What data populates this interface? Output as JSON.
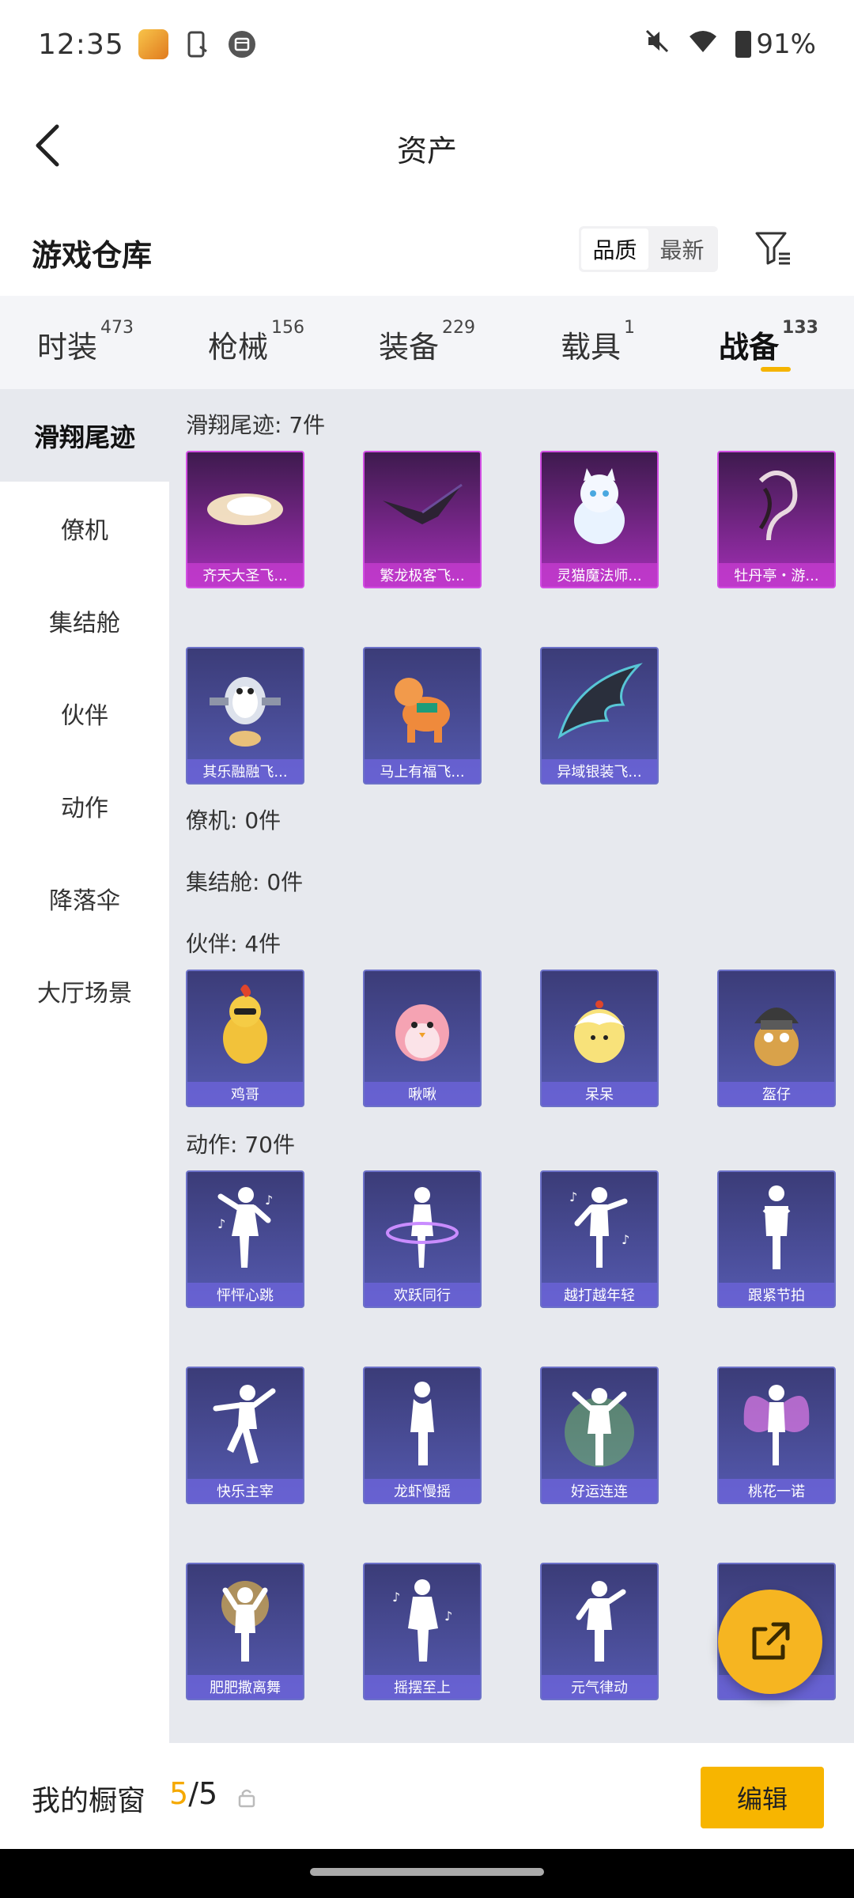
{
  "status_bar": {
    "time": "12:35",
    "battery": "91%",
    "icons": [
      "app-notification-icon",
      "phone-sync-icon",
      "calendar-icon",
      "mute-icon",
      "wifi-icon",
      "battery-icon"
    ]
  },
  "header": {
    "title": "资产",
    "back_icon": "chevron-left-icon"
  },
  "section": {
    "title": "游戏仓库",
    "sort_options": [
      "品质",
      "最新"
    ],
    "sort_selected": "品质",
    "filter_icon": "filter-icon"
  },
  "tabs": [
    {
      "label": "时装",
      "count": "473",
      "active": false
    },
    {
      "label": "枪械",
      "count": "156",
      "active": false
    },
    {
      "label": "装备",
      "count": "229",
      "active": false
    },
    {
      "label": "载具",
      "count": "1",
      "active": false
    },
    {
      "label": "战备",
      "count": "133",
      "active": true
    }
  ],
  "sidebar": [
    {
      "label": "滑翔尾迹",
      "active": true
    },
    {
      "label": "僚机",
      "active": false
    },
    {
      "label": "集结舱",
      "active": false
    },
    {
      "label": "伙伴",
      "active": false
    },
    {
      "label": "动作",
      "active": false
    },
    {
      "label": "降落伞",
      "active": false
    },
    {
      "label": "大厅场景",
      "active": false
    }
  ],
  "categories": {
    "trail": {
      "label": "滑翔尾迹: 7件",
      "items": [
        "齐天大圣飞...",
        "繁龙极客飞...",
        "灵猫魔法师...",
        "牡丹亭・游...",
        "其乐融融飞...",
        "马上有福飞...",
        "异域银装飞..."
      ]
    },
    "wingman": {
      "label": "僚机: 0件"
    },
    "pod": {
      "label": "集结舱: 0件"
    },
    "partner": {
      "label": "伙伴: 4件",
      "items": [
        "鸡哥",
        "啾啾",
        "呆呆",
        "盔仔"
      ]
    },
    "emote": {
      "label": "动作: 70件",
      "items": [
        "怦怦心跳",
        "欢跃同行",
        "越打越年轻",
        "跟紧节拍",
        "快乐主宰",
        "龙虾慢摇",
        "好运连连",
        "桃花一诺",
        "肥肥撒离舞",
        "摇摆至上",
        "元气律动",
        ""
      ]
    }
  },
  "fab_icon": "share-external-icon",
  "bottom_bar": {
    "label": "我的橱窗",
    "current": "5",
    "separator": "/",
    "total": "5",
    "lock_icon": "lock-icon",
    "edit_label": "编辑"
  },
  "colors": {
    "accent": "#f7b500",
    "card_blue": "#555ab0",
    "card_purple": "#a22fb5"
  }
}
